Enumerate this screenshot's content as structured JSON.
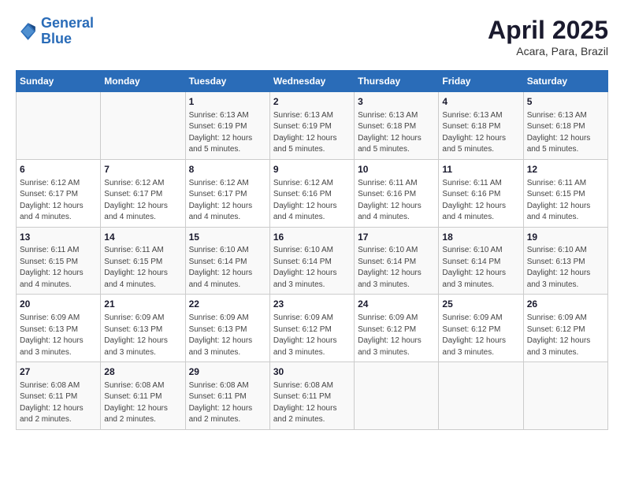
{
  "logo": {
    "line1": "General",
    "line2": "Blue"
  },
  "title": "April 2025",
  "subtitle": "Acara, Para, Brazil",
  "days_header": [
    "Sunday",
    "Monday",
    "Tuesday",
    "Wednesday",
    "Thursday",
    "Friday",
    "Saturday"
  ],
  "weeks": [
    [
      {
        "num": "",
        "info": ""
      },
      {
        "num": "",
        "info": ""
      },
      {
        "num": "1",
        "info": "Sunrise: 6:13 AM\nSunset: 6:19 PM\nDaylight: 12 hours\nand 5 minutes."
      },
      {
        "num": "2",
        "info": "Sunrise: 6:13 AM\nSunset: 6:19 PM\nDaylight: 12 hours\nand 5 minutes."
      },
      {
        "num": "3",
        "info": "Sunrise: 6:13 AM\nSunset: 6:18 PM\nDaylight: 12 hours\nand 5 minutes."
      },
      {
        "num": "4",
        "info": "Sunrise: 6:13 AM\nSunset: 6:18 PM\nDaylight: 12 hours\nand 5 minutes."
      },
      {
        "num": "5",
        "info": "Sunrise: 6:13 AM\nSunset: 6:18 PM\nDaylight: 12 hours\nand 5 minutes."
      }
    ],
    [
      {
        "num": "6",
        "info": "Sunrise: 6:12 AM\nSunset: 6:17 PM\nDaylight: 12 hours\nand 4 minutes."
      },
      {
        "num": "7",
        "info": "Sunrise: 6:12 AM\nSunset: 6:17 PM\nDaylight: 12 hours\nand 4 minutes."
      },
      {
        "num": "8",
        "info": "Sunrise: 6:12 AM\nSunset: 6:17 PM\nDaylight: 12 hours\nand 4 minutes."
      },
      {
        "num": "9",
        "info": "Sunrise: 6:12 AM\nSunset: 6:16 PM\nDaylight: 12 hours\nand 4 minutes."
      },
      {
        "num": "10",
        "info": "Sunrise: 6:11 AM\nSunset: 6:16 PM\nDaylight: 12 hours\nand 4 minutes."
      },
      {
        "num": "11",
        "info": "Sunrise: 6:11 AM\nSunset: 6:16 PM\nDaylight: 12 hours\nand 4 minutes."
      },
      {
        "num": "12",
        "info": "Sunrise: 6:11 AM\nSunset: 6:15 PM\nDaylight: 12 hours\nand 4 minutes."
      }
    ],
    [
      {
        "num": "13",
        "info": "Sunrise: 6:11 AM\nSunset: 6:15 PM\nDaylight: 12 hours\nand 4 minutes."
      },
      {
        "num": "14",
        "info": "Sunrise: 6:11 AM\nSunset: 6:15 PM\nDaylight: 12 hours\nand 4 minutes."
      },
      {
        "num": "15",
        "info": "Sunrise: 6:10 AM\nSunset: 6:14 PM\nDaylight: 12 hours\nand 4 minutes."
      },
      {
        "num": "16",
        "info": "Sunrise: 6:10 AM\nSunset: 6:14 PM\nDaylight: 12 hours\nand 3 minutes."
      },
      {
        "num": "17",
        "info": "Sunrise: 6:10 AM\nSunset: 6:14 PM\nDaylight: 12 hours\nand 3 minutes."
      },
      {
        "num": "18",
        "info": "Sunrise: 6:10 AM\nSunset: 6:14 PM\nDaylight: 12 hours\nand 3 minutes."
      },
      {
        "num": "19",
        "info": "Sunrise: 6:10 AM\nSunset: 6:13 PM\nDaylight: 12 hours\nand 3 minutes."
      }
    ],
    [
      {
        "num": "20",
        "info": "Sunrise: 6:09 AM\nSunset: 6:13 PM\nDaylight: 12 hours\nand 3 minutes."
      },
      {
        "num": "21",
        "info": "Sunrise: 6:09 AM\nSunset: 6:13 PM\nDaylight: 12 hours\nand 3 minutes."
      },
      {
        "num": "22",
        "info": "Sunrise: 6:09 AM\nSunset: 6:13 PM\nDaylight: 12 hours\nand 3 minutes."
      },
      {
        "num": "23",
        "info": "Sunrise: 6:09 AM\nSunset: 6:12 PM\nDaylight: 12 hours\nand 3 minutes."
      },
      {
        "num": "24",
        "info": "Sunrise: 6:09 AM\nSunset: 6:12 PM\nDaylight: 12 hours\nand 3 minutes."
      },
      {
        "num": "25",
        "info": "Sunrise: 6:09 AM\nSunset: 6:12 PM\nDaylight: 12 hours\nand 3 minutes."
      },
      {
        "num": "26",
        "info": "Sunrise: 6:09 AM\nSunset: 6:12 PM\nDaylight: 12 hours\nand 3 minutes."
      }
    ],
    [
      {
        "num": "27",
        "info": "Sunrise: 6:08 AM\nSunset: 6:11 PM\nDaylight: 12 hours\nand 2 minutes."
      },
      {
        "num": "28",
        "info": "Sunrise: 6:08 AM\nSunset: 6:11 PM\nDaylight: 12 hours\nand 2 minutes."
      },
      {
        "num": "29",
        "info": "Sunrise: 6:08 AM\nSunset: 6:11 PM\nDaylight: 12 hours\nand 2 minutes."
      },
      {
        "num": "30",
        "info": "Sunrise: 6:08 AM\nSunset: 6:11 PM\nDaylight: 12 hours\nand 2 minutes."
      },
      {
        "num": "",
        "info": ""
      },
      {
        "num": "",
        "info": ""
      },
      {
        "num": "",
        "info": ""
      }
    ]
  ]
}
